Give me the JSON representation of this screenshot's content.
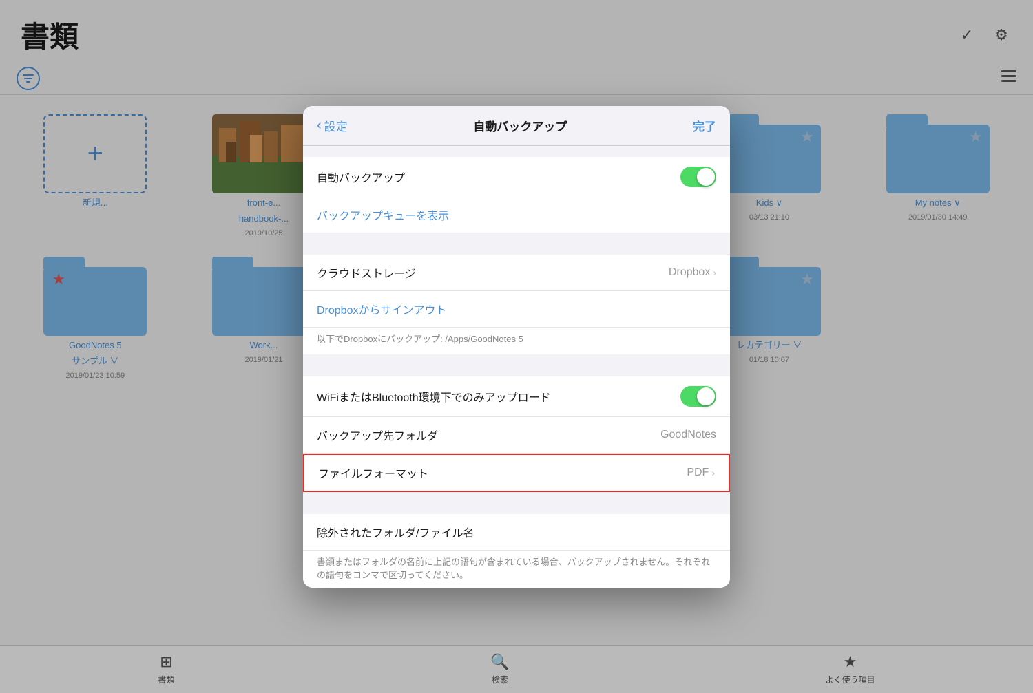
{
  "page": {
    "title": "書類",
    "filter_icon": "≡",
    "list_view_icon": "≡"
  },
  "top_icons": {
    "check_icon": "✓",
    "gear_icon": "⚙"
  },
  "grid_row1": [
    {
      "type": "new",
      "label": "新規...",
      "date": ""
    },
    {
      "type": "thumbnail",
      "label": "front-e...\nhandbook-...",
      "date": "2019/10/25",
      "short_label": "front-e...",
      "sub_label": "handbook-..."
    },
    {
      "type": "empty"
    },
    {
      "type": "empty"
    },
    {
      "type": "folder",
      "starred": true,
      "label": "Kids ∨",
      "date": "03/13 21:10"
    },
    {
      "type": "folder",
      "starred": true,
      "label": "My notes ∨",
      "date": "2019/01/30 14:49"
    }
  ],
  "grid_row2": [
    {
      "type": "folder",
      "red_star": true,
      "label": "GoodNotes 5\nサンプル ∨",
      "date": "2019/01/23 10:59",
      "label_line1": "GoodNotes 5",
      "label_line2": "サンプル ∨"
    },
    {
      "type": "folder",
      "label": "Work...",
      "date": "2019/01/21",
      "short_label": "Work..."
    },
    {
      "type": "empty"
    },
    {
      "type": "empty"
    },
    {
      "type": "folder",
      "starred": true,
      "label": "レカテゴリー ∨",
      "date": "01/18 10:07"
    },
    {
      "type": "empty"
    }
  ],
  "tab_bar": [
    {
      "icon": "⊞",
      "label": "書類"
    },
    {
      "icon": "🔍",
      "label": "検索"
    },
    {
      "icon": "★",
      "label": "よく使う項目"
    }
  ],
  "modal": {
    "back_label": "設定",
    "title": "自動バックアップ",
    "done_label": "完了",
    "rows": [
      {
        "id": "auto-backup",
        "label": "自動バックアップ",
        "type": "toggle",
        "toggle_on": true
      },
      {
        "id": "backup-queue",
        "label": "バックアップキューを表示",
        "type": "link"
      },
      {
        "id": "cloud-storage",
        "label": "クラウドストレージ",
        "type": "value",
        "value": "Dropbox"
      },
      {
        "id": "dropbox-signout",
        "label": "Dropboxからサインアウト",
        "type": "link"
      },
      {
        "id": "dropbox-path",
        "label": "以下でDropboxにバックアップ: /Apps/GoodNotes 5",
        "type": "note"
      },
      {
        "id": "wifi-only",
        "label": "WiFiまたはBluetooth環境下でのみアップロード",
        "type": "toggle",
        "toggle_on": true
      },
      {
        "id": "backup-folder",
        "label": "バックアップ先フォルダ",
        "type": "value",
        "value": "GoodNotes"
      },
      {
        "id": "file-format",
        "label": "ファイルフォーマット",
        "type": "value",
        "value": "PDF",
        "highlighted": true
      },
      {
        "id": "excluded-folders",
        "label": "除外されたフォルダ/ファイル名",
        "type": "header"
      },
      {
        "id": "excluded-note",
        "label": "書類またはフォルダの名前に上記の語句が含まれている場合、バックアップされません。それぞれの語句をコンマで区切ってください。",
        "type": "note-block"
      }
    ]
  }
}
